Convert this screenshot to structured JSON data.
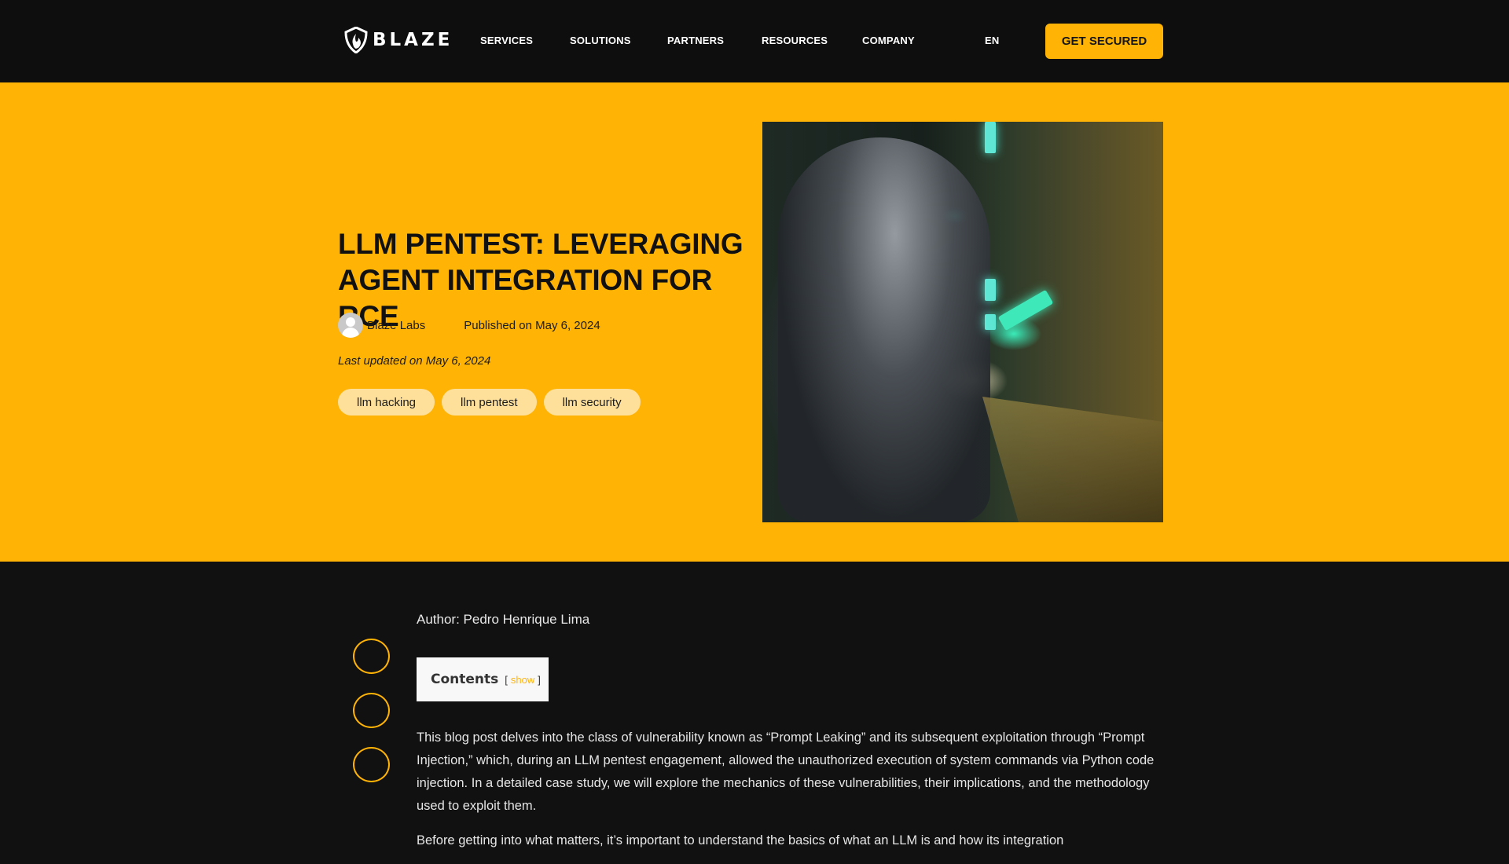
{
  "header": {
    "brand": "BLAZE",
    "nav": [
      {
        "label": "SERVICES"
      },
      {
        "label": "SOLUTIONS"
      },
      {
        "label": "PARTNERS"
      },
      {
        "label": "RESOURCES"
      },
      {
        "label": "COMPANY"
      }
    ],
    "language": "EN",
    "cta_label": "GET SECURED"
  },
  "hero": {
    "title": "LLM PENTEST: LEVERAGING AGENT INTEGRATION FOR RCE",
    "author_name": "Blaze Labs",
    "published": "Published on May 6, 2024",
    "updated": "Last updated on May 6, 2024",
    "tags": [
      "llm hacking",
      "llm pentest",
      "llm security"
    ],
    "image_icon": "cyborg-syringe-illustration"
  },
  "article": {
    "author": "Author: Pedro Henrique Lima",
    "toc": {
      "title": "Contents",
      "open_bracket": "[",
      "toggle_label": "show",
      "close_bracket": "]"
    },
    "paragraphs": [
      "This blog post delves into the class of vulnerability known as “Prompt Leaking” and its subsequent exploitation through “Prompt Injection,” which, during an LLM pentest engagement, allowed the unauthorized execution of system commands via Python code injection. In a detailed case study, we will explore the mechanics of these vulnerabilities, their implications, and the methodology used to exploit them.",
      "Before getting into what matters, it’s important to understand the basics of what an LLM is and how its integration"
    ],
    "share_buttons": [
      "share-button-1",
      "share-button-2",
      "share-button-3"
    ]
  },
  "colors": {
    "accent": "#ffb305",
    "header_bg": "#0e0e0f",
    "body_bg": "#111111",
    "tag_bg": "#ffe09b"
  }
}
